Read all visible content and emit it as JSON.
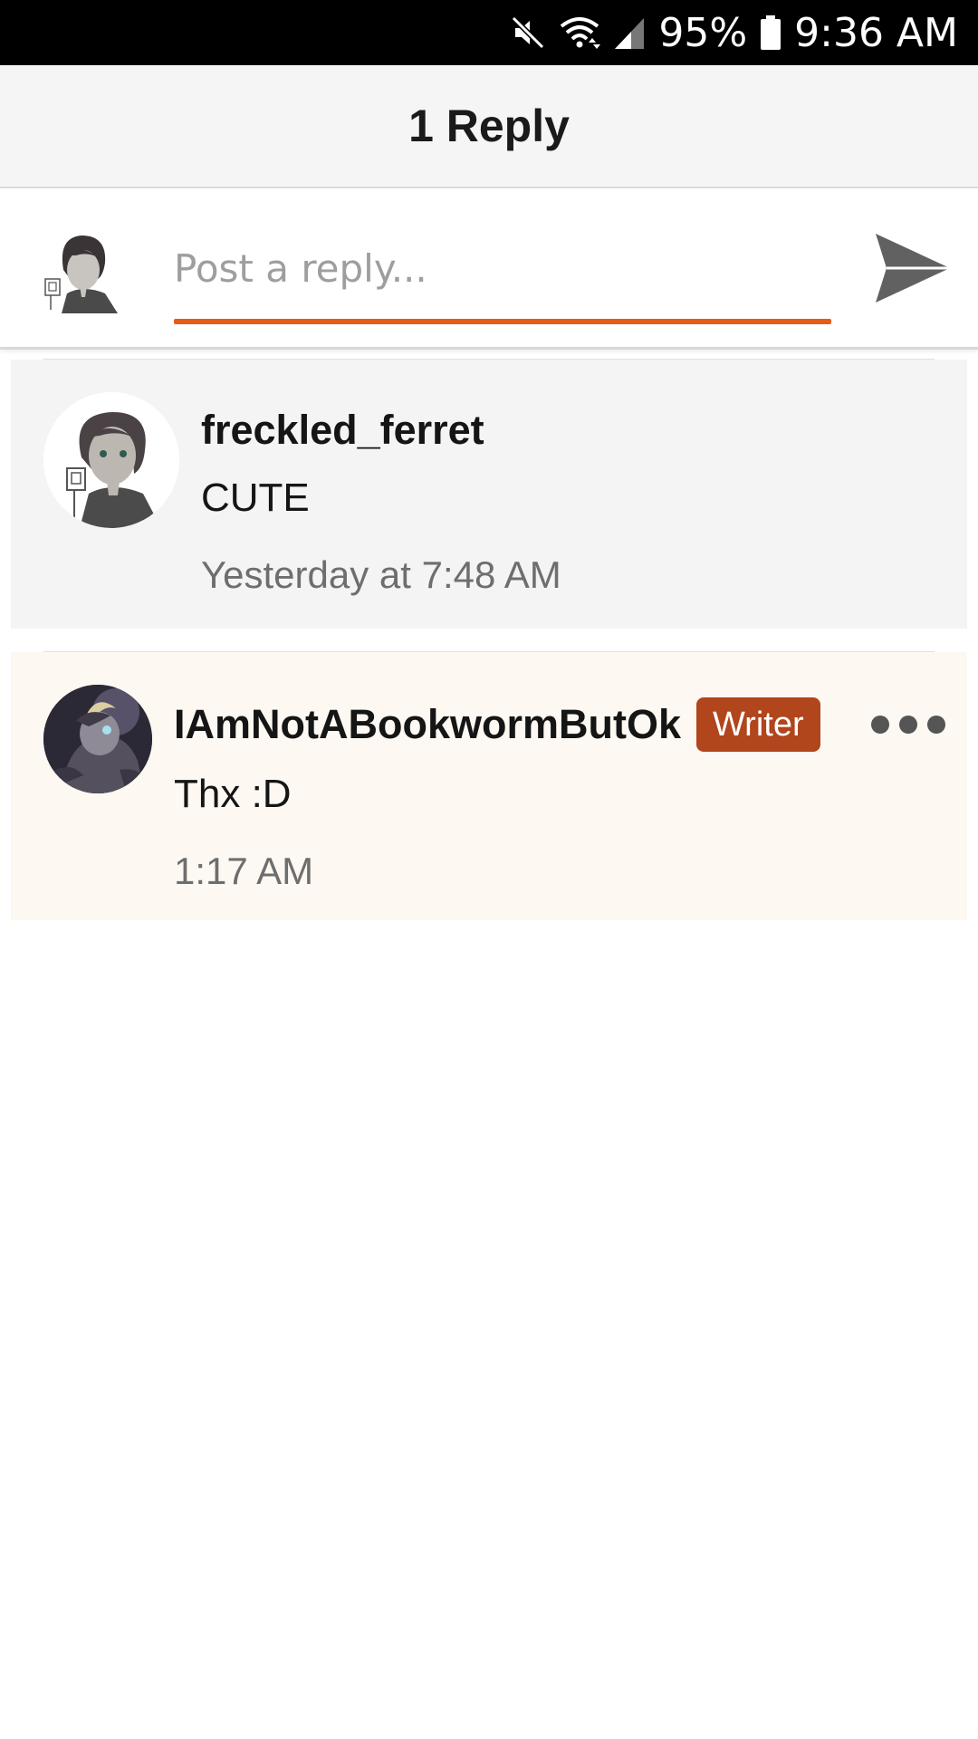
{
  "status_bar": {
    "battery_percent": "95%",
    "time": "9:36 AM",
    "icons": [
      "mute-icon",
      "wifi-icon",
      "signal-icon",
      "battery-icon"
    ]
  },
  "header": {
    "title": "1 Reply"
  },
  "composer": {
    "placeholder": "Post a reply...",
    "value": "",
    "send_icon": "send-icon",
    "accent_color": "#e85a1a"
  },
  "comments": [
    {
      "username": "freckled_ferret",
      "text": "CUTE",
      "timestamp": "Yesterday at 7:48 AM"
    },
    {
      "username": "IAmNotABookwormButOk",
      "badge": "Writer",
      "badge_color": "#b1451c",
      "text": "Thx :D",
      "timestamp": "1:17 AM",
      "menu_icon": "more-icon"
    }
  ]
}
